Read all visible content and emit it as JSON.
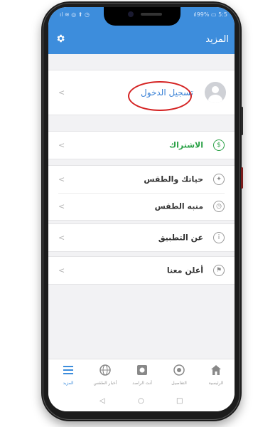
{
  "status_bar": {
    "left": "ıl ≋ ◎ ⬆ ◷",
    "right": "ıl99% ▭ 5:5"
  },
  "header": {
    "title": "المزيد",
    "settings_icon": "gear-icon",
    "accent_color": "#3d8ddc"
  },
  "account": {
    "login_label": "تسجيل الدخول",
    "login_color": "#3b82d6",
    "highlight_color": "#d42222"
  },
  "menu": {
    "subscription_label": "الاشتراك",
    "subscription_color": "#2aa146",
    "life_weather_label": "حياتك والطقس",
    "weather_alarm_label": "منبه الطقس",
    "about_label": "عن التطبيق",
    "advertise_label": "أعلن معنا"
  },
  "bottom_nav": {
    "home_label": "الرئيسية",
    "details_label": "التفاصيل",
    "observer_label": "أنت الراصد",
    "weather_news_label": "أخبار الطقس",
    "more_label": "المزيد"
  },
  "system_nav": {
    "back": "◁",
    "home": "○",
    "recents": "□"
  }
}
